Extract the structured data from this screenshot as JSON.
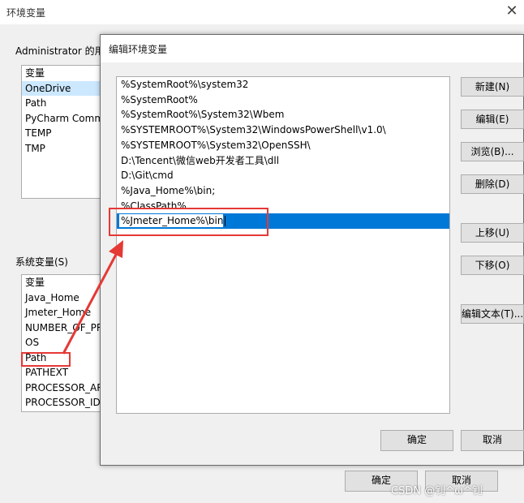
{
  "outer_window": {
    "title": "环境变量",
    "user_group_label": "Administrator 的用户变量(U)",
    "user_vars_header": "变量",
    "user_vars": [
      "OneDrive",
      "Path",
      "PyCharm Community Edition",
      "TEMP",
      "TMP"
    ],
    "system_group_label": "系统变量(S)",
    "system_vars_header": "变量",
    "system_vars": [
      "Java_Home",
      "Jmeter_Home",
      "NUMBER_OF_PROCESSORS",
      "OS",
      "Path",
      "PATHEXT",
      "PROCESSOR_ARCHITECTURE",
      "PROCESSOR_IDENTIFIER"
    ],
    "ok_label": "确定",
    "cancel_label": "取消"
  },
  "dialog": {
    "title": "编辑环境变量",
    "paths": [
      "%SystemRoot%\\system32",
      "%SystemRoot%",
      "%SystemRoot%\\System32\\Wbem",
      "%SYSTEMROOT%\\System32\\WindowsPowerShell\\v1.0\\",
      "%SYSTEMROOT%\\System32\\OpenSSH\\",
      "D:\\Tencent\\微信web开发者工具\\dll",
      "D:\\Git\\cmd",
      "%Java_Home%\\bin;",
      "%ClassPath%"
    ],
    "editing_value": "%Jmeter_Home%\\bin",
    "buttons": {
      "new": "新建(N)",
      "edit": "编辑(E)",
      "browse": "浏览(B)...",
      "delete": "删除(D)",
      "move_up": "上移(U)",
      "move_down": "下移(O)",
      "edit_text": "编辑文本(T)..."
    },
    "ok_label": "确定",
    "cancel_label": "取消"
  },
  "watermark": "CSDN @钊^ω^钊",
  "colors": {
    "annotation": "#e53935",
    "selection": "#0078d7"
  }
}
